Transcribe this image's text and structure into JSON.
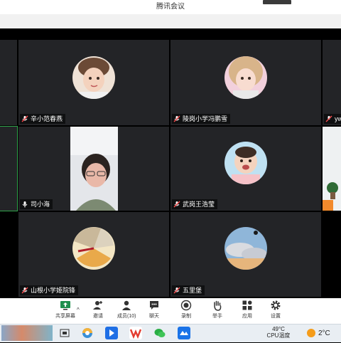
{
  "window": {
    "title": "腾讯会议"
  },
  "participants": [
    {
      "id": "p1",
      "name": "辛小范春燕",
      "mic": "muted"
    },
    {
      "id": "p2",
      "name": "陵岗小学冯鹏雪",
      "mic": "muted"
    },
    {
      "id": "p3",
      "name": "yw",
      "mic": "muted"
    },
    {
      "id": "p4",
      "name": "司小海",
      "mic": "on"
    },
    {
      "id": "p5",
      "name": "武岗王浩莹",
      "mic": "muted"
    },
    {
      "id": "p6",
      "name": "山根小学姬院锋",
      "mic": "muted"
    },
    {
      "id": "p7",
      "name": "五里堡",
      "mic": "muted"
    }
  ],
  "toolbar": {
    "share_label": "共享屏幕",
    "invite_label": "邀请",
    "members_label": "成员(10)",
    "chat_label": "聊天",
    "record_label": "录制",
    "raise_hand_label": "举手",
    "apps_label": "应用",
    "settings_label": "设置"
  },
  "taskbar": {
    "cpu_temp_value": "49°C",
    "cpu_temp_label": "CPU温度",
    "weather_temp": "2°C"
  },
  "colors": {
    "tile_bg": "#232427",
    "active_speaker": "#2fa34a",
    "accent": "#1f6fe5"
  }
}
